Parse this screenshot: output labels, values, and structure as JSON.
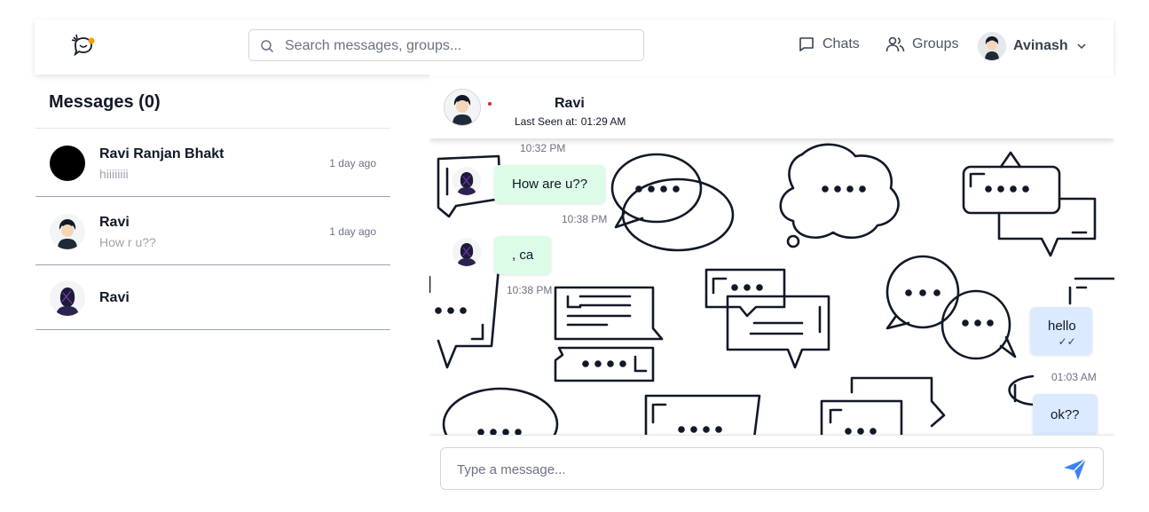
{
  "colors": {
    "accent": "#3b82f6",
    "incoming_bubble": "#dcfce7",
    "outgoing_bubble": "#dbeafe",
    "status_dot": "#dc2626"
  },
  "navbar": {
    "logo_icon": "chat-bird-logo-icon",
    "search_placeholder": "Search messages, groups...",
    "chats_label": "Chats",
    "groups_label": "Groups",
    "user_name": "Avinash"
  },
  "sidebar": {
    "title": "Messages (0)",
    "conversations": [
      {
        "name": "Ravi Ranjan Bhakt",
        "preview": "hiiiiiiii",
        "time": "1 day ago"
      },
      {
        "name": "Ravi",
        "preview": "How r u??",
        "time": "1 day ago"
      },
      {
        "name": "Ravi",
        "preview": "",
        "time": ""
      }
    ]
  },
  "chat": {
    "contact_name": "Ravi",
    "last_seen_label": "Last Seen at:",
    "last_seen_time": "01:29 AM",
    "messages": [
      {
        "time_above": "10:32 PM",
        "text": "How are u??",
        "time": "10:38 PM"
      },
      {
        "text": ", ca",
        "time": "10:38 PM"
      },
      {
        "text": "hello",
        "ticks": "✓✓",
        "time": "01:03 AM"
      },
      {
        "text": "ok??"
      }
    ],
    "input_placeholder": "Type a message..."
  }
}
